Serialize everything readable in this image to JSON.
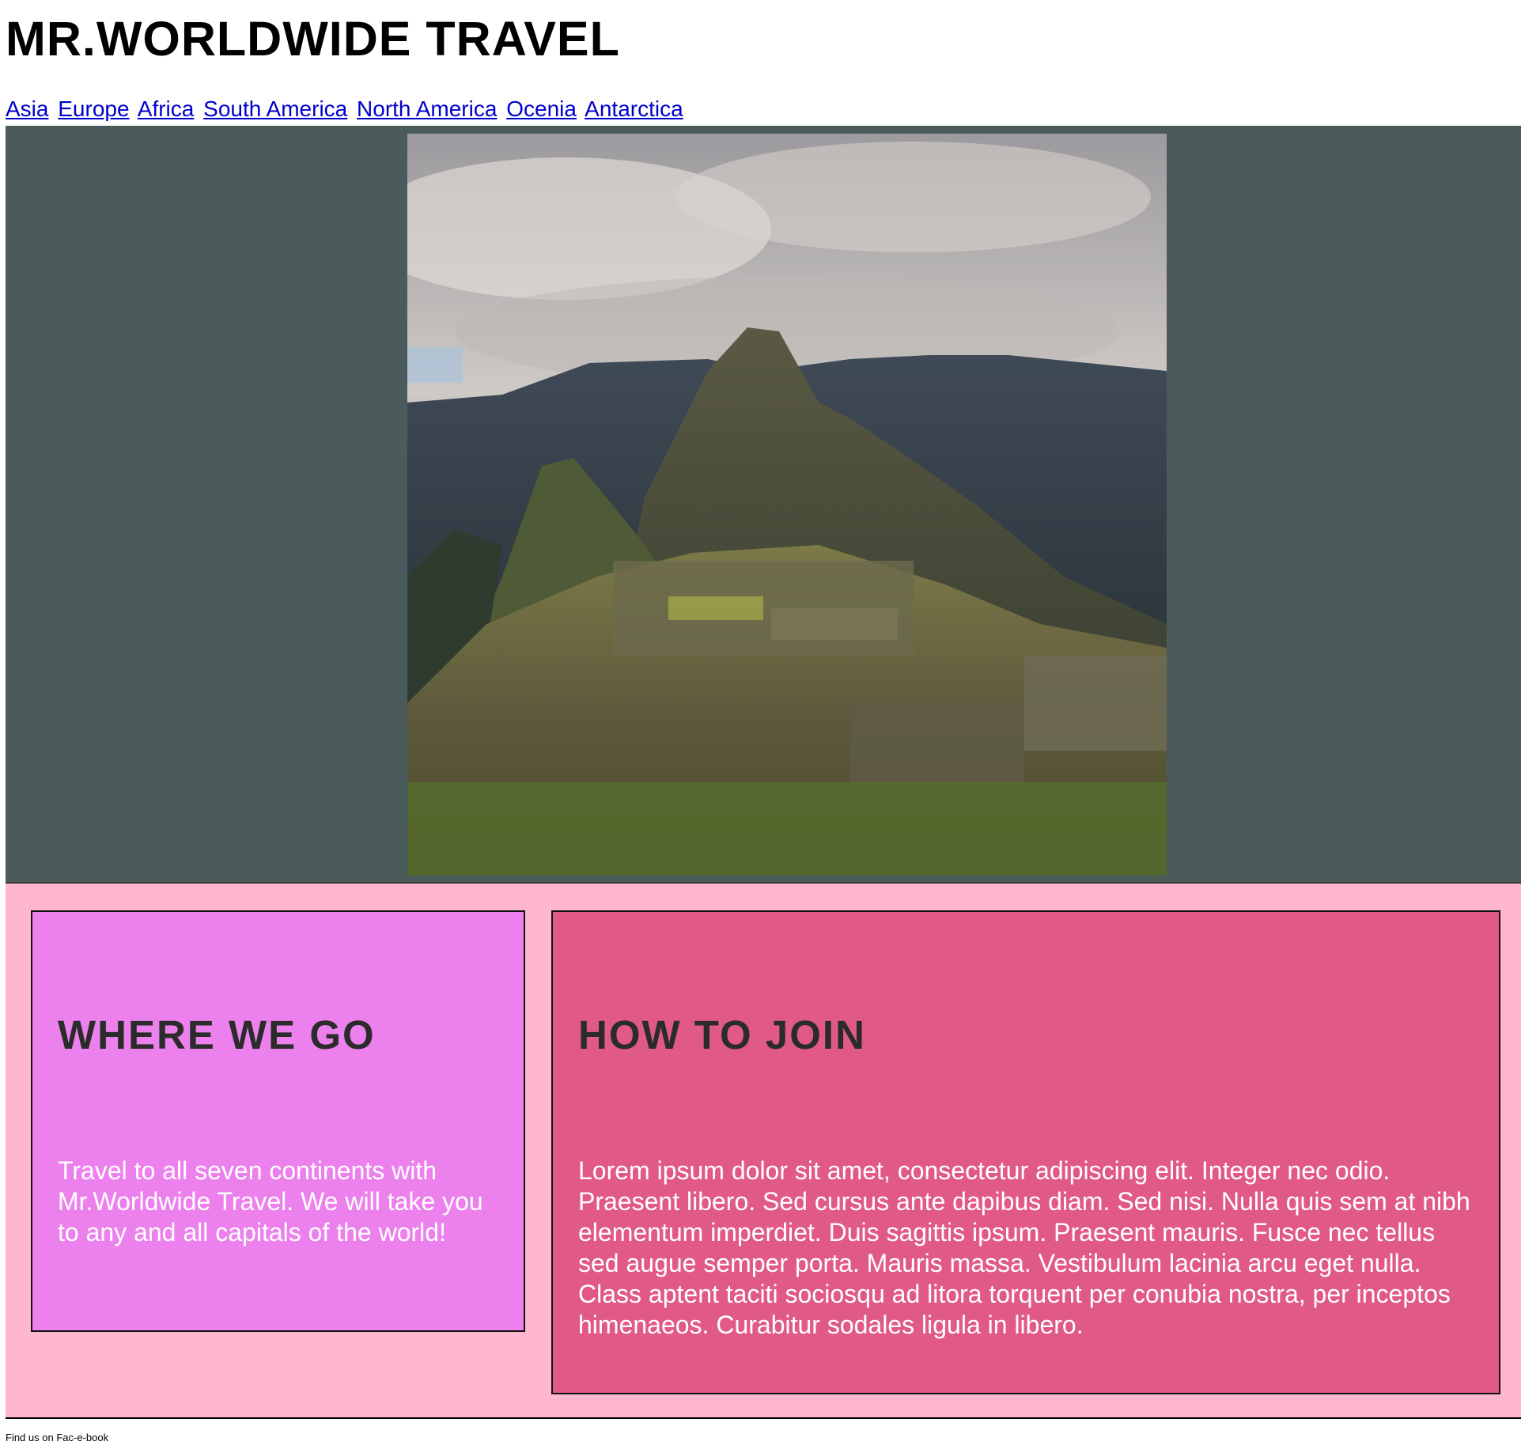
{
  "header": {
    "title": "MR.WORLDWIDE TRAVEL"
  },
  "nav": {
    "links": [
      "Asia",
      "Europe",
      "Africa",
      "South America",
      "North America",
      "Ocenia",
      "Antarctica"
    ]
  },
  "hero": {
    "image": "mountain-ruins-photo"
  },
  "sections": {
    "where": {
      "heading": "WHERE WE GO",
      "body": "Travel to all seven continents with Mr.Worldwide Travel. We will take you to any and all capitals of the world!"
    },
    "join": {
      "heading": "HOW TO JOIN",
      "body": "Lorem ipsum dolor sit amet, consectetur adipiscing elit. Integer nec odio. Praesent libero. Sed cursus ante dapibus diam. Sed nisi. Nulla quis sem at nibh elementum imperdiet. Duis sagittis ipsum. Praesent mauris. Fusce nec tellus sed augue semper porta. Mauris massa. Vestibulum lacinia arcu eget nulla. Class aptent taciti sociosqu ad litora torquent per conubia nostra, per inceptos himenaeos. Curabitur sodales ligula in libero."
    }
  },
  "footer": {
    "text": "Find us on Fac-e-book"
  },
  "colors": {
    "hero_bg": "#4b5b5b",
    "content_bg": "#ffb7cf",
    "where_card": "#ec81ee",
    "join_card": "#e15a87",
    "link": "#0000cc"
  }
}
